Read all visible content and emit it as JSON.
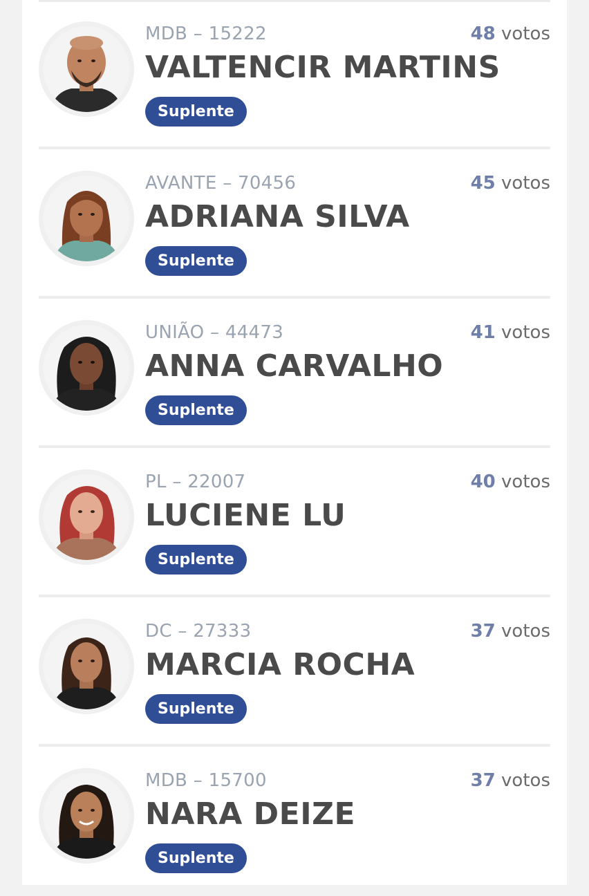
{
  "badge_color": "#2f4e96",
  "vote_number_color": "#6f7fa8",
  "candidates": [
    {
      "party_number": "MDB – 15222",
      "name": "VALTENCIR MARTINS",
      "votes": "48",
      "votes_label": "votos",
      "status": "Suplente",
      "photo": "man-bald-beard-photo"
    },
    {
      "party_number": "AVANTE – 70456",
      "name": "ADRIANA SILVA",
      "votes": "45",
      "votes_label": "votos",
      "status": "Suplente",
      "photo": "woman-brown-hair-photo"
    },
    {
      "party_number": "UNIÃO – 44473",
      "name": "ANNA CARVALHO",
      "votes": "41",
      "votes_label": "votos",
      "status": "Suplente",
      "photo": "woman-curly-black-hair-photo"
    },
    {
      "party_number": "PL – 22007",
      "name": "LUCIENE LU",
      "votes": "40",
      "votes_label": "votos",
      "status": "Suplente",
      "photo": "woman-red-hair-photo"
    },
    {
      "party_number": "DC – 27333",
      "name": "MARCIA ROCHA",
      "votes": "37",
      "votes_label": "votos",
      "status": "Suplente",
      "photo": "woman-dark-hair-photo"
    },
    {
      "party_number": "MDB – 15700",
      "name": "NARA DEIZE",
      "votes": "37",
      "votes_label": "votos",
      "status": "Suplente",
      "photo": "woman-long-dark-hair-photo"
    }
  ]
}
